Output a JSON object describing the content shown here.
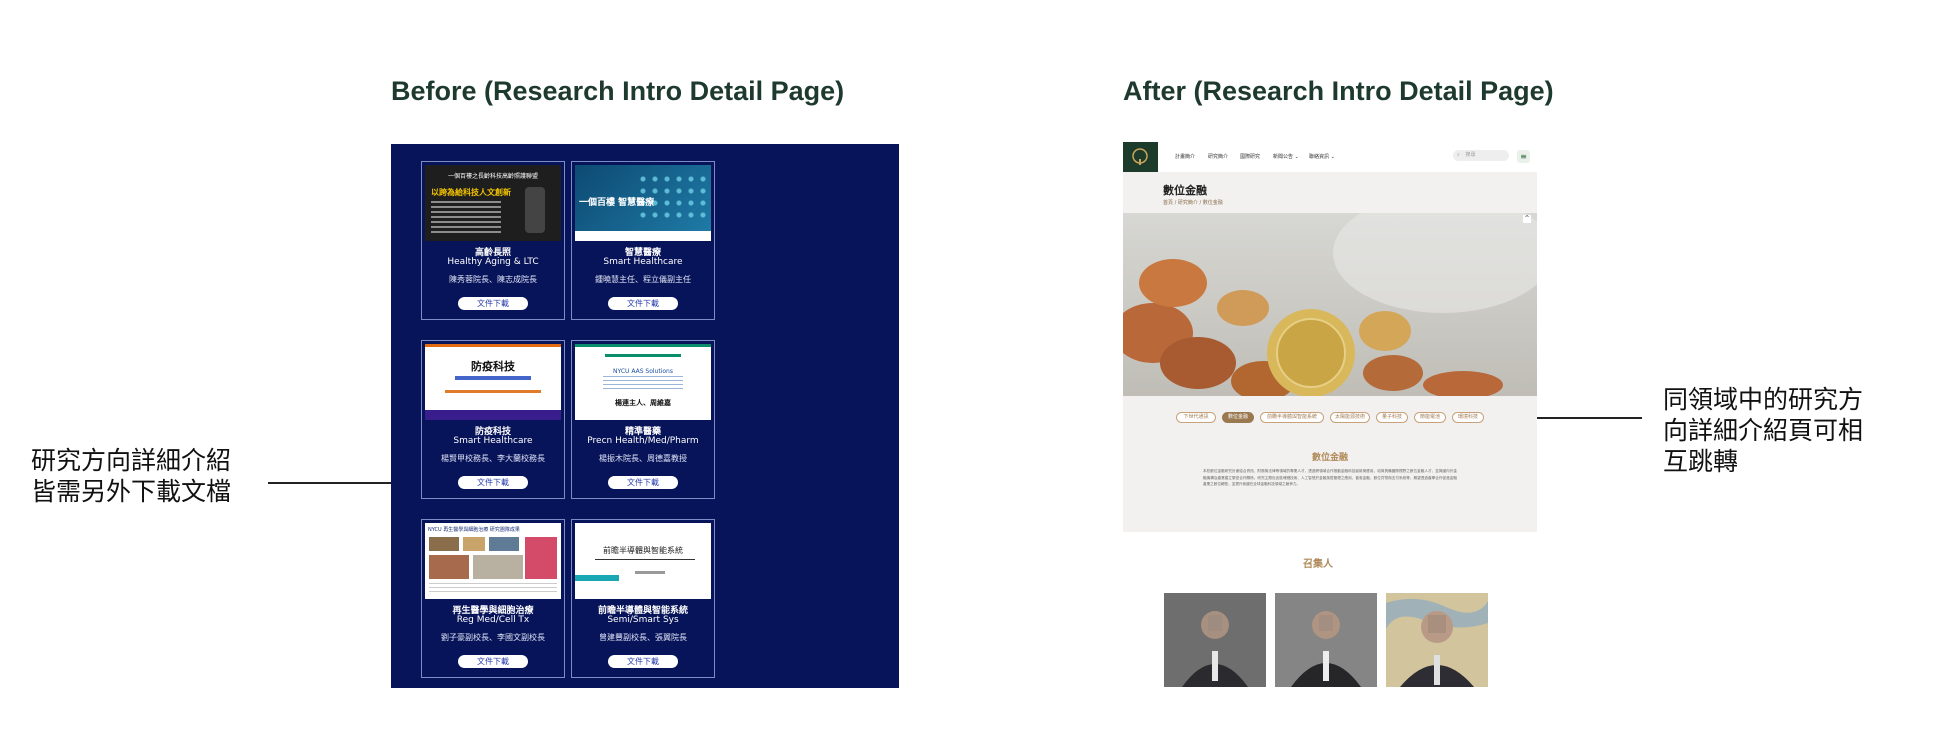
{
  "before": {
    "heading": "Before (Research Intro Detail Page)",
    "annotation_lines": [
      "研究方向詳細介紹",
      "皆需另外下載文檔"
    ],
    "cards": [
      {
        "thumb_line1": "一個百樓之長齡科技高齡照護聯盟",
        "thumb_line2": "以跨為給科技人文創新",
        "title_zh": "高齡長照",
        "title_en": "Healthy Aging & LTC",
        "people": "陳秀蓉院長、陳志成院長",
        "button": "文件下載"
      },
      {
        "thumb_line1": "一個百樓 智慧醫療",
        "thumb_line2": "",
        "title_zh": "智慧醫療",
        "title_en": "Smart Healthcare",
        "people": "鍾曉慧主任、程立儀副主任",
        "button": "文件下載"
      },
      {
        "thumb_line1": "防疫科技",
        "thumb_line2": "",
        "title_zh": "防疫科技",
        "title_en": "Smart Healthcare",
        "people": "楊賢甲校務長、李大蘭校務長",
        "button": "文件下載"
      },
      {
        "thumb_line1": "NYCU AAS Solutions",
        "thumb_line2": "楊連主人、周維嘉",
        "title_zh": "精準醫藥",
        "title_en": "Precn Health/Med/Pharm",
        "people": "楊振木院長、周德嘉教授",
        "button": "文件下載"
      },
      {
        "thumb_line1": "NYCU 再生醫學與細胞治療 研究團隊成果",
        "thumb_line2": "",
        "title_zh": "再生醫學與細胞治療",
        "title_en": "Reg Med/Cell Tx",
        "people": "劉子豪副校長、李國文副校長",
        "button": "文件下載"
      },
      {
        "thumb_line1": "前瞻半導體與智能系統",
        "thumb_line2": "",
        "title_zh": "前瞻半導體與智能系統",
        "title_en": "Semi/Smart Sys",
        "people": "曾建豐副校長、張翼院長",
        "button": "文件下載"
      }
    ]
  },
  "after": {
    "heading": "After (Research Intro Detail Page)",
    "annotation_lines": [
      "同領域中的研究方",
      "向詳細介紹頁可相",
      "互跳轉"
    ],
    "nav_items": [
      "計畫簡介",
      "研究簡介",
      "國際研究",
      "新聞公告 ⌄",
      "聯絡資訊 ⌄"
    ],
    "search_placeholder": "搜尋",
    "page_title": "數位金融",
    "breadcrumb": "首頁 / 研究簡介 / 數位金融",
    "pills": [
      "下世代通訊",
      "數位金融",
      "前瞻半導體與智能系統",
      "太陽能源技術",
      "量子科技",
      "節能電池",
      "環境科技"
    ],
    "active_pill_index": 1,
    "section_title": "數位金融",
    "section_text": "本校數位金融研究計畫結合資訊、財務與法律等領域的專業人才，透過跨領域合作推動金融科技創新與應用，培育具備國際視野之數位金融人才，並與國內外金融機構及產業建立緊密合作關係。研究主題包含區塊鏈技術、人工智慧於金融風險管理之應用、普惠金融、數位貨幣與支付系統等，期望透過產學合作促進金融產業之數位轉型，並提升我國在全球金融科技領域之競爭力。",
    "convener_label": "召集人"
  }
}
